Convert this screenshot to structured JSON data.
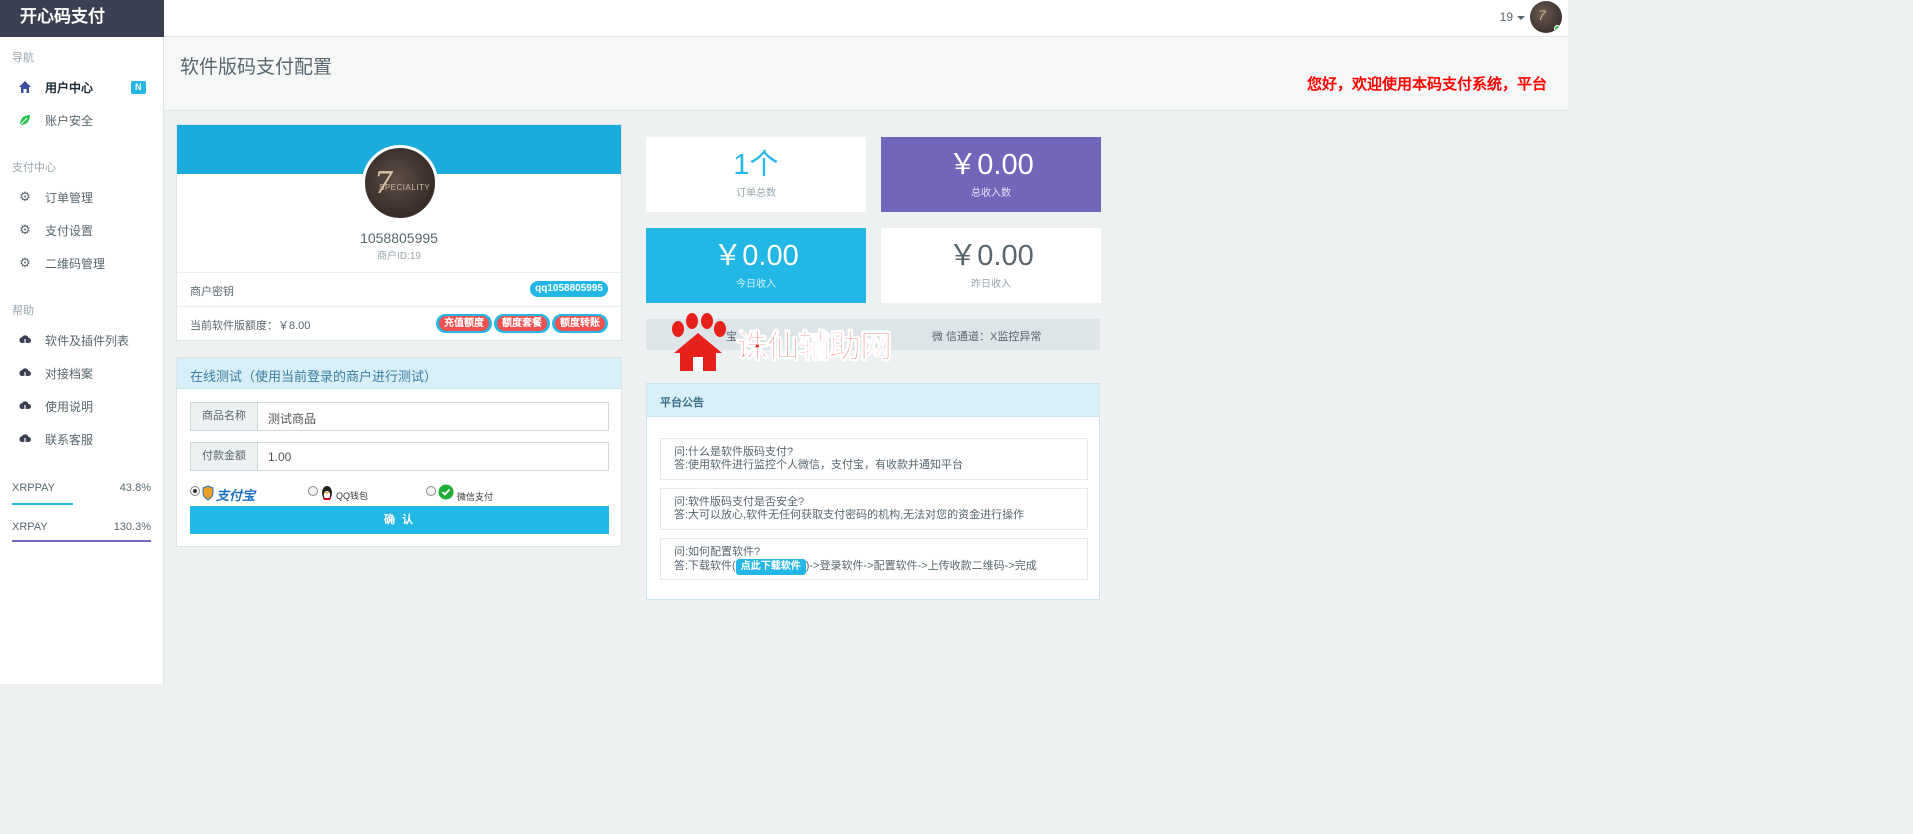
{
  "brand": "开心码支付",
  "header": {
    "user_id": "19"
  },
  "sidebar": {
    "nav_header": "导航",
    "nav_items": [
      {
        "label": "用户中心",
        "icon": "home-icon",
        "badge": "N"
      },
      {
        "label": "账户安全",
        "icon": "leaf-icon"
      }
    ],
    "pay_header": "支付中心",
    "pay_items": [
      {
        "label": "订单管理",
        "icon": "gear-icon"
      },
      {
        "label": "支付设置",
        "icon": "gear-icon"
      },
      {
        "label": "二维码管理",
        "icon": "gear-icon"
      }
    ],
    "help_header": "帮助",
    "help_items": [
      {
        "label": "软件及插件列表",
        "icon": "cloud-download-icon"
      },
      {
        "label": "对接档案",
        "icon": "cloud-download-icon"
      },
      {
        "label": "使用说明",
        "icon": "cloud-download-icon"
      },
      {
        "label": "联系客服",
        "icon": "cloud-download-icon"
      }
    ],
    "stats": [
      {
        "name": "XRPPAY",
        "value": "43.8%",
        "fill": 0.438,
        "color": "#23b7e5"
      },
      {
        "name": "XRPAY",
        "value": "130.3%",
        "fill": 1.0,
        "color": "#7266ba"
      }
    ]
  },
  "page": {
    "title": "软件版码支付配置",
    "marquee": "您好，欢迎使用本码支付系统，平台"
  },
  "profile": {
    "name": "1058805995",
    "merchant_id": "商户ID:19",
    "key_label": "商户密钥",
    "key_value": "qq1058805995",
    "quota_label": "当前软件版额度：￥8.00",
    "buttons": [
      "充值额度",
      "额度套餐",
      "额度转账"
    ]
  },
  "test": {
    "title": "在线测试（使用当前登录的商户进行测试）",
    "product_label": "商品名称",
    "product_value": "测试商品",
    "amount_label": "付款金额",
    "amount_value": "1.00",
    "pay_methods": [
      {
        "label": "支付宝",
        "checked": true
      },
      {
        "label": "QQ钱包",
        "checked": false
      },
      {
        "label": "微信支付",
        "checked": false
      }
    ],
    "confirm": "确 认"
  },
  "tiles": [
    {
      "value": "1个",
      "label": "订单总数",
      "bg": "#ffffff",
      "color": "#23b7e5",
      "label_color": "#98a6ad"
    },
    {
      "value": "￥0.00",
      "label": "总收入数",
      "bg": "#7266ba",
      "color": "#ffffff",
      "label_color": "#e6e3f3"
    },
    {
      "value": "￥0.00",
      "label": "今日收入",
      "bg": "#23b7e5",
      "color": "#ffffff",
      "label_color": "#d9f1fb"
    },
    {
      "value": "￥0.00",
      "label": "昨日收入",
      "bg": "#ffffff",
      "color": "#58666e",
      "label_color": "#98a6ad"
    }
  ],
  "status_strip": {
    "left": "宝",
    "right": "微 信通道：X监控异常"
  },
  "watermark": "诛仙辅助网",
  "notice": {
    "title": "平台公告",
    "faqs": [
      {
        "q": "问:什么是软件版码支付?",
        "a": "答:使用软件进行监控个人微信，支付宝，有收款并通知平台"
      },
      {
        "q": "问:软件版码支付是否安全?",
        "a": "答:大可以放心,软件无任何获取支付密码的机构,无法对您的资金进行操作"
      },
      {
        "q": "问:如何配置软件?",
        "a_prefix": "答:下载软件(",
        "a_button": "点此下载软件",
        "a_suffix": ")->登录软件->配置软件->上传收款二维码->完成"
      }
    ]
  }
}
